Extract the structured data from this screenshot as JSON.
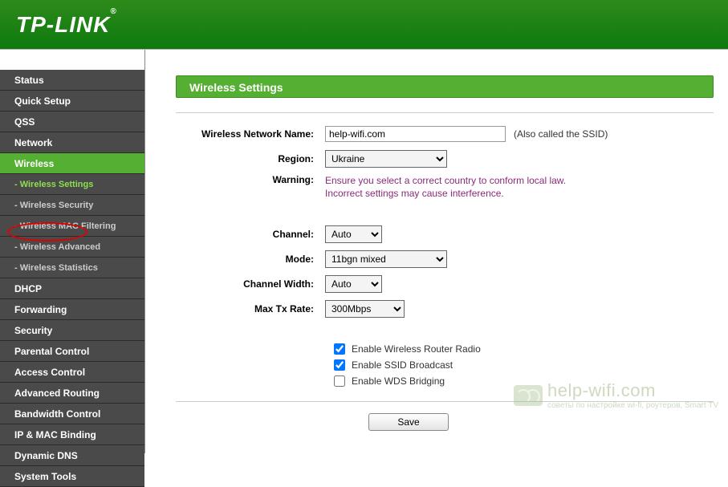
{
  "brand": "TP-LINK",
  "sidebar": {
    "items": [
      {
        "label": "Status"
      },
      {
        "label": "Quick Setup"
      },
      {
        "label": "QSS"
      },
      {
        "label": "Network"
      },
      {
        "label": "Wireless",
        "active": true
      },
      {
        "label": "- Wireless Settings",
        "sub": true,
        "active": true
      },
      {
        "label": "- Wireless Security",
        "sub": true
      },
      {
        "label": "- Wireless MAC Filtering",
        "sub": true
      },
      {
        "label": "- Wireless Advanced",
        "sub": true
      },
      {
        "label": "- Wireless Statistics",
        "sub": true
      },
      {
        "label": "DHCP"
      },
      {
        "label": "Forwarding"
      },
      {
        "label": "Security"
      },
      {
        "label": "Parental Control"
      },
      {
        "label": "Access Control"
      },
      {
        "label": "Advanced Routing"
      },
      {
        "label": "Bandwidth Control"
      },
      {
        "label": "IP & MAC Binding"
      },
      {
        "label": "Dynamic DNS"
      },
      {
        "label": "System Tools"
      }
    ]
  },
  "panel": {
    "title": "Wireless Settings"
  },
  "form": {
    "network_name_label": "Wireless Network Name:",
    "network_name_value": "help-wifi.com",
    "ssid_hint": "(Also called the SSID)",
    "region_label": "Region:",
    "region_value": "Ukraine",
    "warning_label": "Warning:",
    "warning_text1": "Ensure you select a correct country to conform local law.",
    "warning_text2": "Incorrect settings may cause interference.",
    "channel_label": "Channel:",
    "channel_value": "Auto",
    "mode_label": "Mode:",
    "mode_value": "11bgn mixed",
    "chanwidth_label": "Channel Width:",
    "chanwidth_value": "Auto",
    "maxtx_label": "Max Tx Rate:",
    "maxtx_value": "300Mbps",
    "cb_radio": "Enable Wireless Router Radio",
    "cb_ssid": "Enable SSID Broadcast",
    "cb_wds": "Enable WDS Bridging",
    "save_label": "Save"
  },
  "watermark": {
    "title": "help-wifi.com",
    "subtitle": "советы по настройке wi-fi, роутеров, Smart TV"
  }
}
